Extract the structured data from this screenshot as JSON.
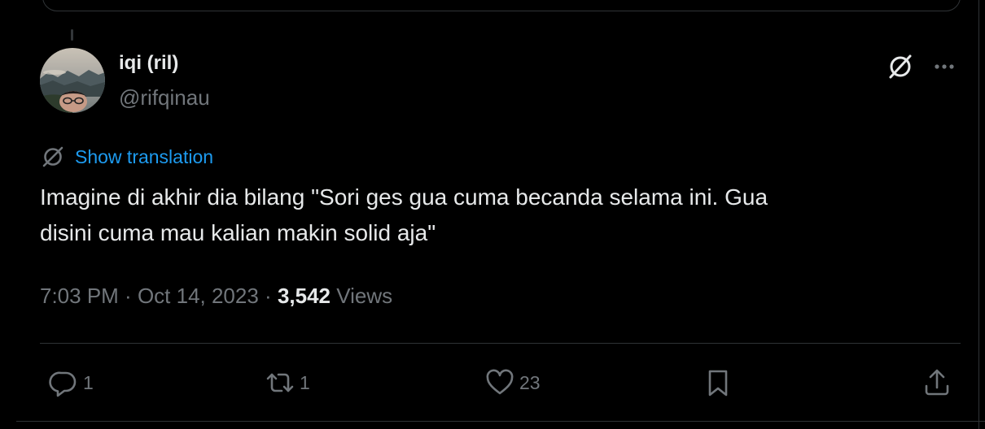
{
  "author": {
    "display_name": "iqi (ril)",
    "handle": "@rifqinau"
  },
  "header_icons": {
    "grok": "grok-slash-icon",
    "more": "more-icon"
  },
  "translation": {
    "icon": "translate-icon",
    "label": "Show translation"
  },
  "tweet": {
    "text_lines": [
      "Imagine di akhir dia bilang \"Sori ges gua cuma becanda selama ini. Gua",
      "disini cuma mau kalian makin solid aja\""
    ]
  },
  "meta": {
    "time": "7:03 PM",
    "separator": " · ",
    "date": "Oct 14, 2023",
    "views_count": "3,542",
    "views_label": "Views"
  },
  "actions": {
    "reply": {
      "icon": "reply-icon",
      "count": "1"
    },
    "repost": {
      "icon": "repost-icon",
      "count": "1"
    },
    "like": {
      "icon": "like-icon",
      "count": "23"
    },
    "bookmark": {
      "icon": "bookmark-icon"
    },
    "share": {
      "icon": "share-icon"
    }
  },
  "colors": {
    "background": "#000000",
    "text_primary": "#e7e9ea",
    "text_secondary": "#71767b",
    "accent": "#1d9bf0",
    "border": "#2f3336"
  }
}
